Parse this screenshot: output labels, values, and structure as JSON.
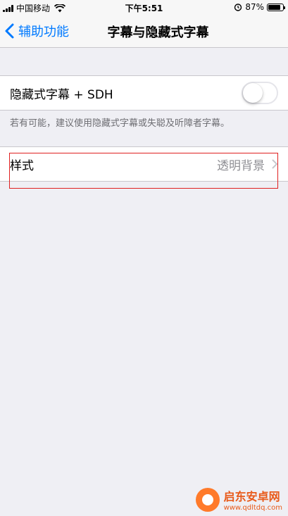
{
  "status_bar": {
    "carrier": "中国移动",
    "time": "下午5:51",
    "battery_percent": "87%",
    "battery_level": 0.87
  },
  "nav": {
    "back_label": "辅助功能",
    "title": "字幕与隐藏式字幕"
  },
  "section1": {
    "toggle_label": "隐藏式字幕 + SDH",
    "toggle_on": false,
    "footnote": "若有可能，建议使用隐藏式字幕或失聪及听障者字幕。"
  },
  "section2": {
    "style_label": "样式",
    "style_value": "透明背景"
  },
  "watermark": {
    "title": "启东安卓网",
    "url": "www.qdltdq.com"
  },
  "colors": {
    "accent": "#007aff",
    "highlight": "#e02020",
    "background": "#efeff4"
  }
}
